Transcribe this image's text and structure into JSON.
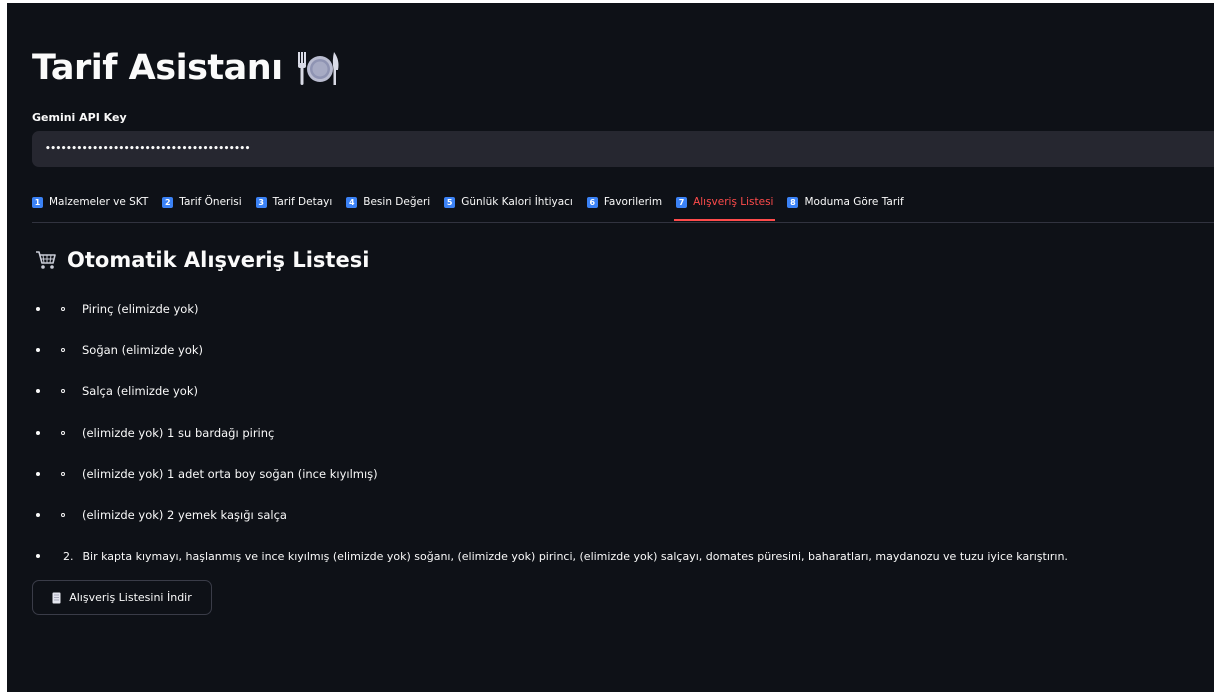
{
  "app": {
    "title": "Tarif Asistanı",
    "title_icon": "plate-with-cutlery-icon"
  },
  "api_key": {
    "label": "Gemini API Key",
    "value": "•••••••••••••••••••••••••••••••••••••••"
  },
  "tabs": [
    {
      "number": "1",
      "label": "Malzemeler ve SKT",
      "active": false
    },
    {
      "number": "2",
      "label": "Tarif Önerisi",
      "active": false
    },
    {
      "number": "3",
      "label": "Tarif Detayı",
      "active": false
    },
    {
      "number": "4",
      "label": "Besin Değeri",
      "active": false
    },
    {
      "number": "5",
      "label": "Günlük Kalori İhtiyacı",
      "active": false
    },
    {
      "number": "6",
      "label": "Favorilerim",
      "active": false
    },
    {
      "number": "7",
      "label": "Alışveriş Listesi",
      "active": true
    },
    {
      "number": "8",
      "label": "Moduma Göre Tarif",
      "active": false
    }
  ],
  "section": {
    "title": "Otomatik Alışveriş Listesi",
    "icon": "shopping-cart-icon"
  },
  "shopping_list": {
    "sub_items": [
      "Pirinç (elimizde yok)",
      "Soğan (elimizde yok)",
      "Salça (elimizde yok)",
      "(elimizde yok) 1 su bardağı pirinç",
      "(elimizde yok) 1 adet orta boy soğan (ince kıyılmış)",
      "(elimizde yok) 2 yemek kaşığı salça"
    ],
    "step_number": "2.",
    "step_text": "Bir kapta kıymayı, haşlanmış ve ince kıyılmış (elimizde yok) soğanı, (elimizde yok) pirinci, (elimizde yok) salçayı, domates püresini, baharatları, maydanozu ve tuzu iyice karıştırın."
  },
  "download_button": {
    "label": "Alışveriş Listesini İndir",
    "icon": "scroll-icon"
  },
  "colors": {
    "background": "#0e1117",
    "input_bg": "#262730",
    "accent": "#ff4b4b",
    "tab_badge": "#3b82f6",
    "text": "#fafafa"
  }
}
